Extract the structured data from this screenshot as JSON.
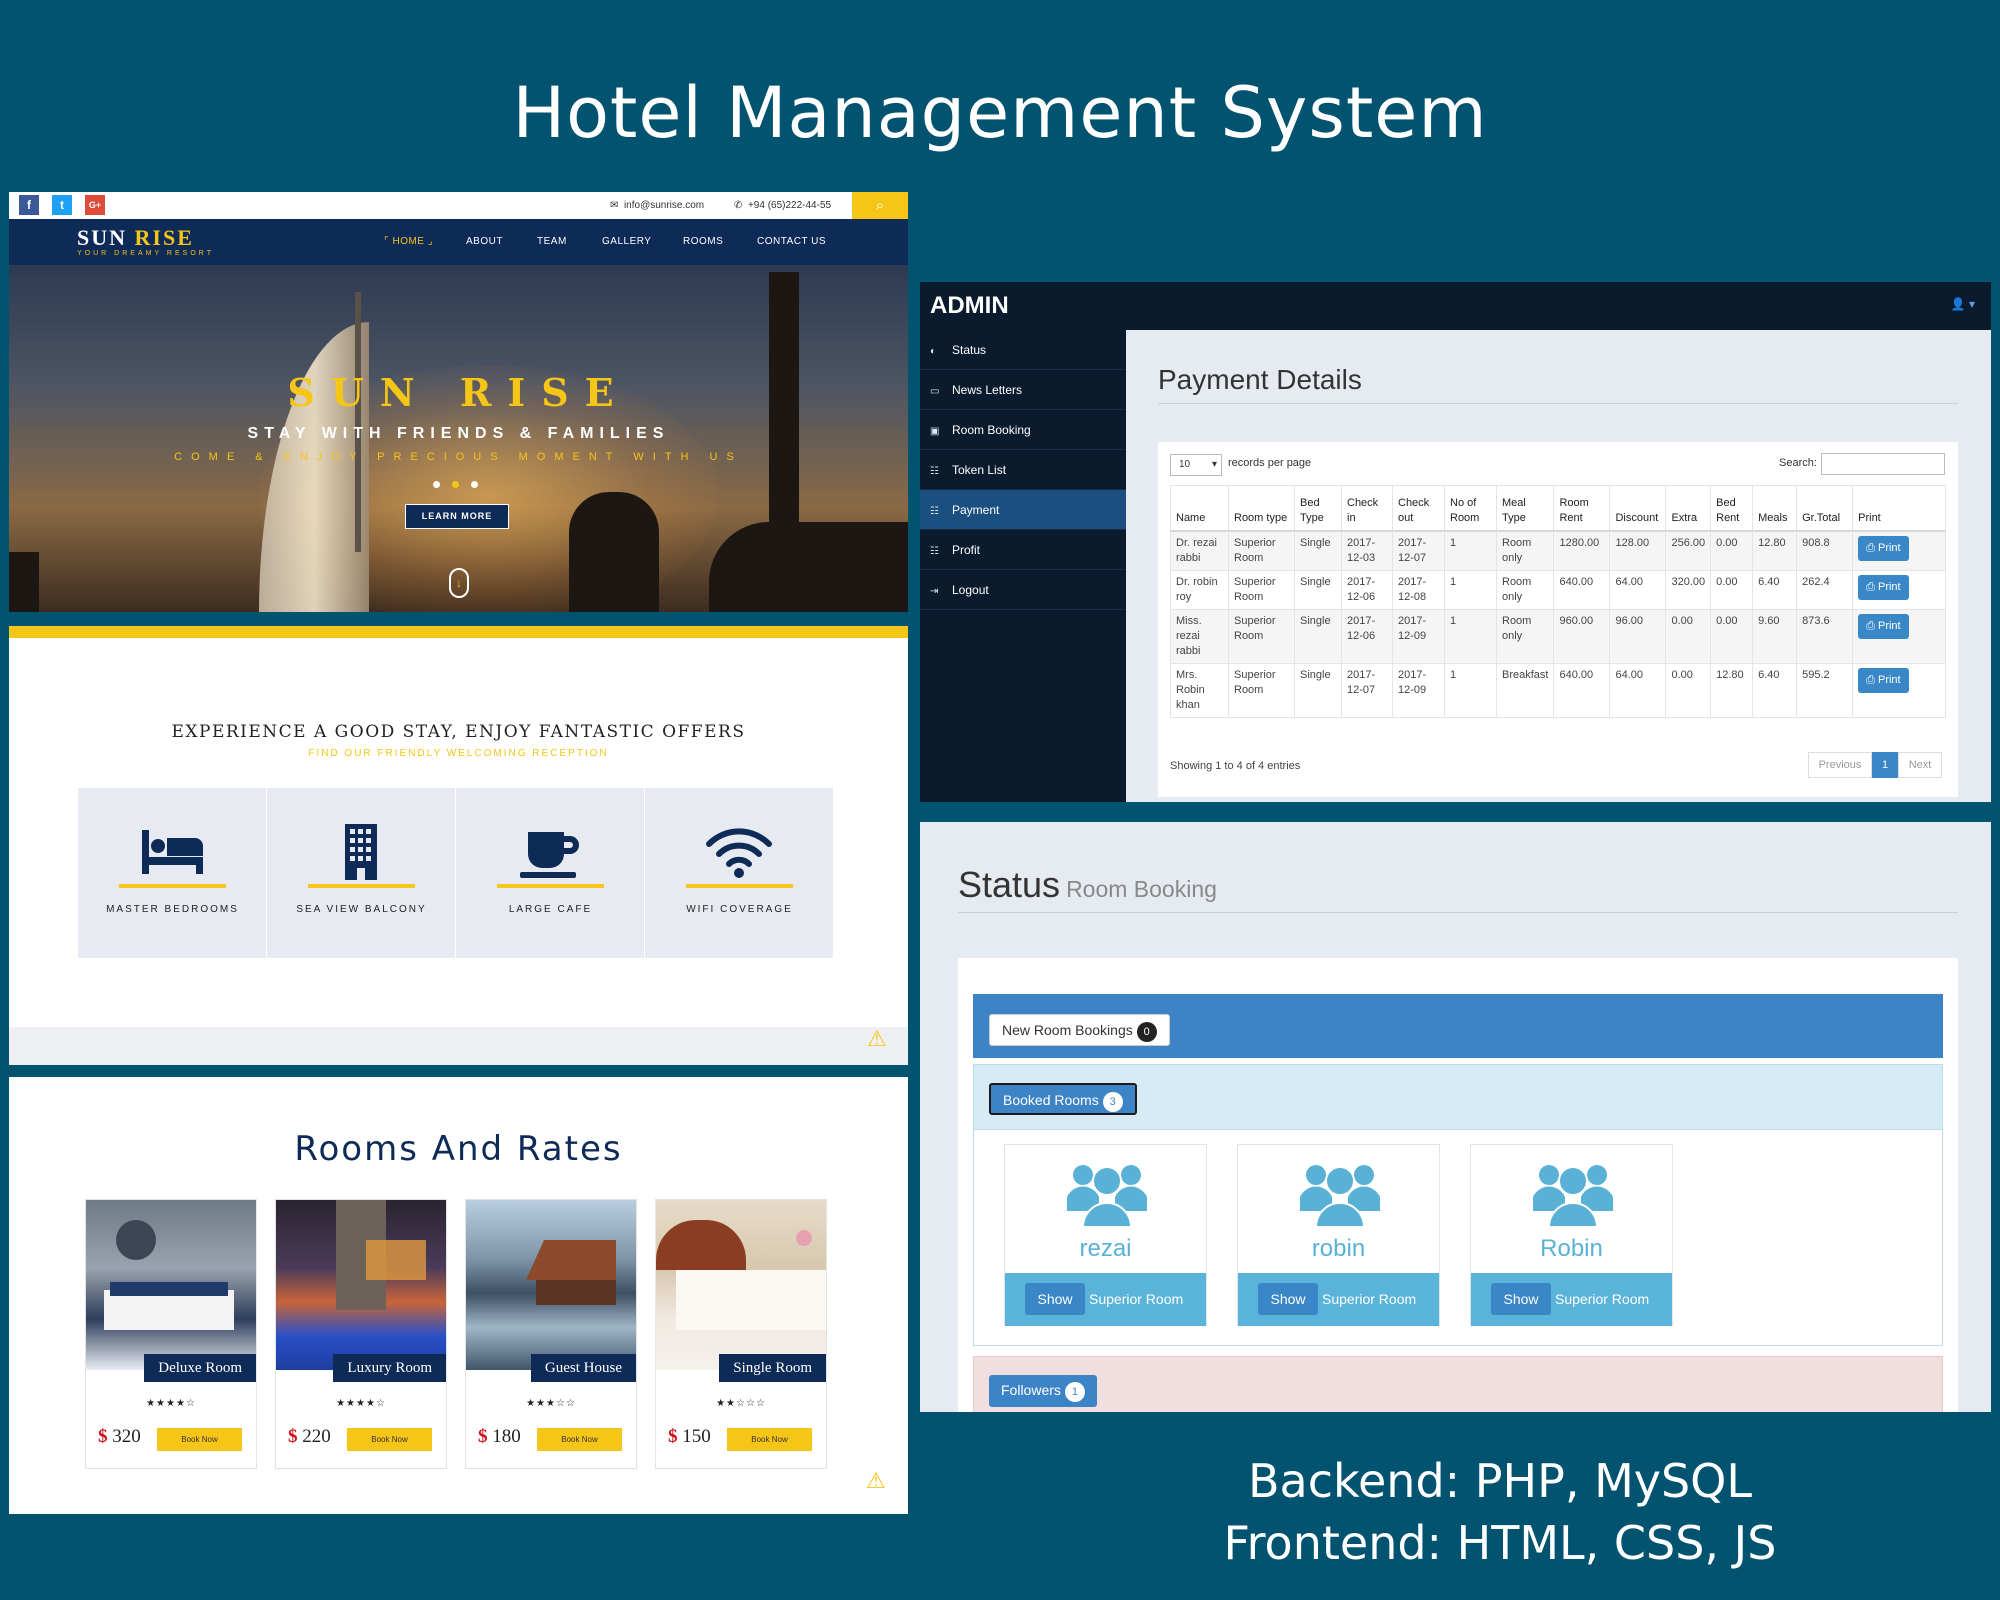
{
  "page": {
    "title": "Hotel Management System",
    "backend": "Backend: PHP, MySQL",
    "frontend": "Frontend: HTML, CSS, JS"
  },
  "site": {
    "topbar": {
      "social": [
        {
          "name": "facebook-icon",
          "glyph": "f",
          "color": "#3b5998"
        },
        {
          "name": "twitter-icon",
          "glyph": "t",
          "color": "#1da1f2"
        },
        {
          "name": "google-plus-icon",
          "glyph": "G+",
          "color": "#dd4b39"
        }
      ],
      "email": "info@sunrise.com",
      "phone": "+94 (65)222-44-55"
    },
    "logo": {
      "word1": "SUN",
      "word2": "RISE",
      "tagline": "YOUR DREAMY RESORT"
    },
    "nav": [
      "HOME",
      "ABOUT",
      "TEAM",
      "GALLERY",
      "ROOMS",
      "CONTACT US"
    ],
    "nav_active": "HOME",
    "hero": {
      "title": "SUN RISE",
      "subtitle": "STAY WITH FRIENDS & FAMILIES",
      "tagline": "COME & ENJOY PRECIOUS MOMENT WITH US",
      "button": "LEARN MORE"
    },
    "facilities": {
      "title": "EXPERIENCE A GOOD STAY, ENJOY FANTASTIC OFFERS",
      "subtitle": "FIND OUR FRIENDLY WELCOMING RECEPTION",
      "items": [
        {
          "label": "MASTER BEDROOMS",
          "icon": "bed-icon"
        },
        {
          "label": "SEA VIEW BALCONY",
          "icon": "building-icon"
        },
        {
          "label": "LARGE CAFE",
          "icon": "coffee-cup-icon"
        },
        {
          "label": "WIFI COVERAGE",
          "icon": "wifi-icon"
        }
      ]
    },
    "rooms": {
      "title": "Rooms And Rates",
      "book_label": "Book Now",
      "currency": "$",
      "items": [
        {
          "name": "Deluxe Room",
          "price": "320",
          "stars": "★★★★☆"
        },
        {
          "name": "Luxury Room",
          "price": "220",
          "stars": "★★★★☆"
        },
        {
          "name": "Guest House",
          "price": "180",
          "stars": "★★★☆☆"
        },
        {
          "name": "Single Room",
          "price": "150",
          "stars": "★★☆☆☆"
        }
      ]
    }
  },
  "admin": {
    "brand": "ADMIN",
    "sidebar": [
      {
        "label": "Status",
        "icon": "dashboard-icon"
      },
      {
        "label": "News Letters",
        "icon": "monitor-icon"
      },
      {
        "label": "Room Booking",
        "icon": "image-icon"
      },
      {
        "label": "Token List",
        "icon": "list-icon"
      },
      {
        "label": "Payment",
        "icon": "list-icon",
        "active": true
      },
      {
        "label": "Profit",
        "icon": "list-icon"
      },
      {
        "label": "Logout",
        "icon": "logout-icon"
      }
    ],
    "payment": {
      "title": "Payment Details",
      "length_value": "10",
      "length_label": "records per page",
      "search_label": "Search:",
      "columns": [
        "Name",
        "Room type",
        "Bed Type",
        "Check in",
        "Check out",
        "No of Room",
        "Meal Type",
        "Room Rent",
        "Discount",
        "Extra",
        "Bed Rent",
        "Meals",
        "Gr.Total",
        "Print"
      ],
      "rows": [
        [
          "Dr. rezai rabbi",
          "Superior Room",
          "Single",
          "2017-12-03",
          "2017-12-07",
          "1",
          "Room only",
          "1280.00",
          "128.00",
          "256.00",
          "0.00",
          "12.80",
          "908.8"
        ],
        [
          "Dr. robin roy",
          "Superior Room",
          "Single",
          "2017-12-06",
          "2017-12-08",
          "1",
          "Room only",
          "640.00",
          "64.00",
          "320.00",
          "0.00",
          "6.40",
          "262.4"
        ],
        [
          "Miss. rezai rabbi",
          "Superior Room",
          "Single",
          "2017-12-06",
          "2017-12-09",
          "1",
          "Room only",
          "960.00",
          "96.00",
          "0.00",
          "0.00",
          "9.60",
          "873.6"
        ],
        [
          "Mrs. Robin khan",
          "Superior Room",
          "Single",
          "2017-12-07",
          "2017-12-09",
          "1",
          "Breakfast",
          "640.00",
          "64.00",
          "0.00",
          "12.80",
          "6.40",
          "595.2"
        ]
      ],
      "print_label": "Print",
      "info": "Showing 1 to 4 of 4 entries",
      "pager": {
        "previous": "Previous",
        "current": "1",
        "next": "Next"
      }
    },
    "status": {
      "title": "Status",
      "subtitle": "Room Booking",
      "new_bookings_label": "New Room Bookings",
      "new_bookings_count": "0",
      "booked_label": "Booked Rooms",
      "booked_count": "3",
      "followers_label": "Followers",
      "followers_count": "1",
      "show_label": "Show",
      "users": [
        {
          "name": "rezai",
          "room": "Superior Room"
        },
        {
          "name": "robin",
          "room": "Superior Room"
        },
        {
          "name": "Robin",
          "room": "Superior Room"
        }
      ]
    }
  }
}
